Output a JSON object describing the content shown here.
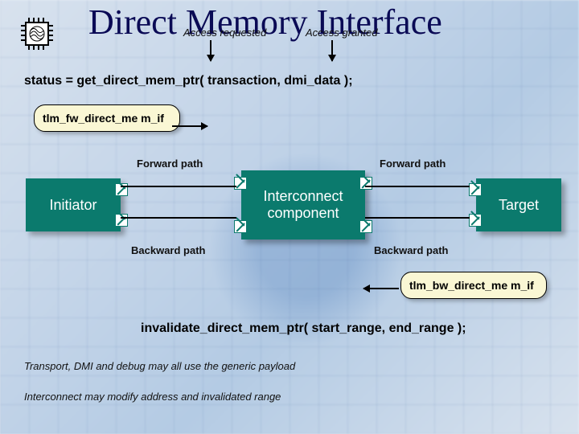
{
  "title": "Direct Memory Interface",
  "subtitle": {
    "requested": "Access requested",
    "granted": "Access granted"
  },
  "status_line": "status = get_direct_mem_ptr( transaction, dmi_data );",
  "callouts": {
    "fw": "tlm_fw_direct_me m_if",
    "bw": "tlm_bw_direct_me m_if"
  },
  "nodes": {
    "initiator": "Initiator",
    "interconnect_l1": "Interconnect",
    "interconnect_l2": "component",
    "target": "Target"
  },
  "path_labels": {
    "fw_left": "Forward path",
    "fw_right": "Forward path",
    "bw_left": "Backward path",
    "bw_right": "Backward path"
  },
  "invalidate_line": "invalidate_direct_mem_ptr( start_range, end_range );",
  "notes": {
    "n1": "Transport, DMI and debug may all use the generic payload",
    "n2": "Interconnect may modify address and invalidated range"
  }
}
